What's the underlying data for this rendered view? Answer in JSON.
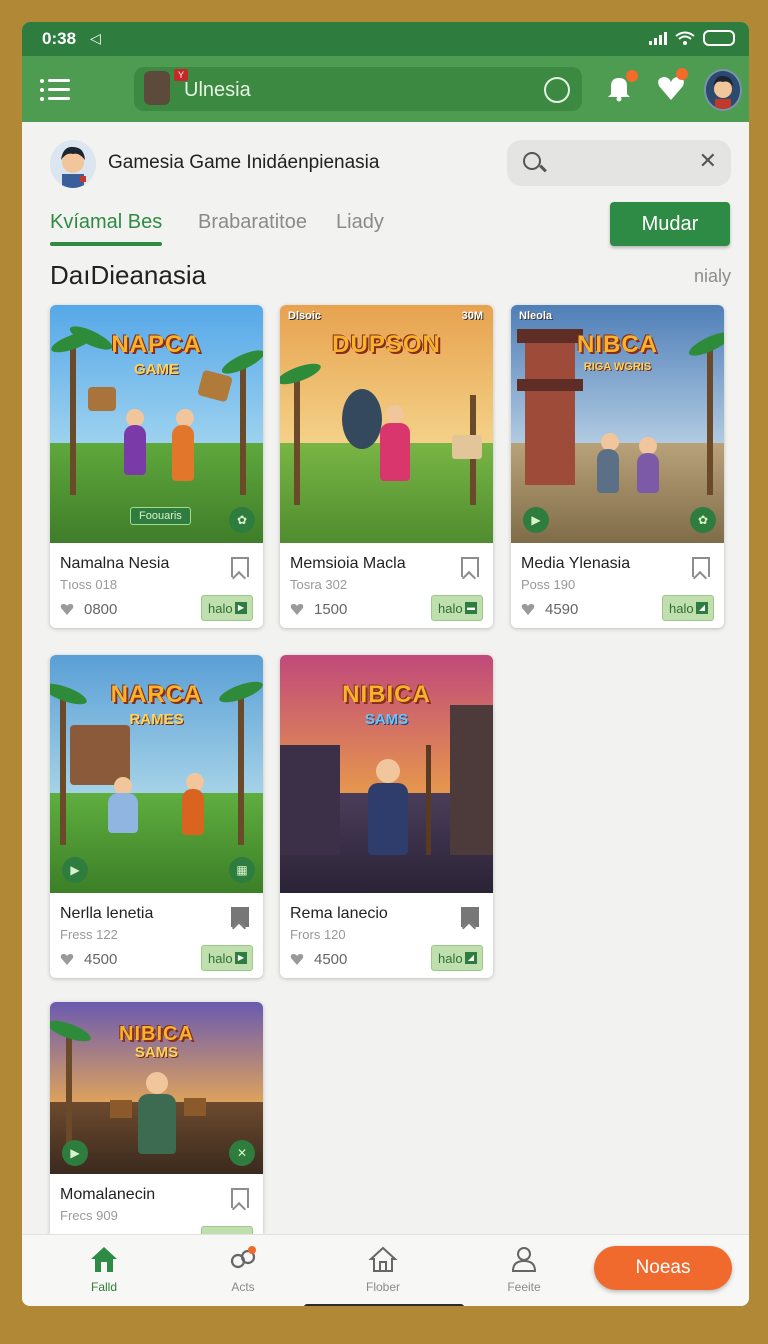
{
  "status_bar": {
    "time": "0:38",
    "nav_glyph": "◁"
  },
  "app_bar": {
    "search_text": "Ulnesia",
    "badge": "Y"
  },
  "header": {
    "title": "Gamesia Game Inidáenpienasia"
  },
  "tabs": [
    {
      "label": "Kvíamal Bes",
      "active": true
    },
    {
      "label": "Brabaratitoe",
      "active": false
    },
    {
      "label": "Liady",
      "active": false
    }
  ],
  "actions": {
    "mudar": "Mudar"
  },
  "section": {
    "title": "DaıDieanasia",
    "link": "nialy"
  },
  "cards": [
    {
      "title": "Namalna Nesia",
      "sub": "Tıoss 018",
      "likes": "0800",
      "chip": "halo",
      "logo": "NAPCA",
      "logo2": "GAME",
      "corner": "",
      "caption": "Foouaris",
      "bookmark": "outline"
    },
    {
      "title": "Memsioia Macla",
      "sub": "Tosra 302",
      "likes": "1500",
      "chip": "halo",
      "logo": "DUPSON",
      "logo2": "",
      "corner": "Dlsoic",
      "corner2": "30M",
      "bookmark": "outline"
    },
    {
      "title": "Media Ylenasia",
      "sub": "Poss 190",
      "likes": "4590",
      "chip": "halo",
      "logo": "NIBCA",
      "logo2": "RIGA WGRIS",
      "corner": "Nleola",
      "bookmark": "outline"
    },
    {
      "title": "Nerlla lenetia",
      "sub": "Fress 122",
      "likes": "4500",
      "chip": "halo",
      "logo": "NARCA",
      "logo2": "RAMES",
      "corner": "",
      "bookmark": "filled"
    },
    {
      "title": "Rema lanecio",
      "sub": "Frors 120",
      "likes": "4500",
      "chip": "halo",
      "logo": "NIBICA",
      "logo2": "SAMS",
      "corner": "",
      "bookmark": "filled"
    },
    {
      "title": "Momalanecin",
      "sub": "Frecs 909",
      "likes": "",
      "chip": "",
      "logo": "NIBICA",
      "logo2": "SAMS",
      "corner": "",
      "bookmark": "outline"
    }
  ],
  "bottom_nav": [
    {
      "label": "Falld",
      "icon": "home-icon",
      "active": true
    },
    {
      "label": "Acts",
      "icon": "activity-icon",
      "active": false
    },
    {
      "label": "Flober",
      "icon": "house-outline-icon",
      "active": false
    },
    {
      "label": "Feeite",
      "icon": "profile-icon",
      "active": false
    }
  ],
  "fab": {
    "label": "Noeas"
  },
  "colors": {
    "primary": "#2f7d3e",
    "accent": "#ef6a2c",
    "appbar": "#4e9b52"
  }
}
